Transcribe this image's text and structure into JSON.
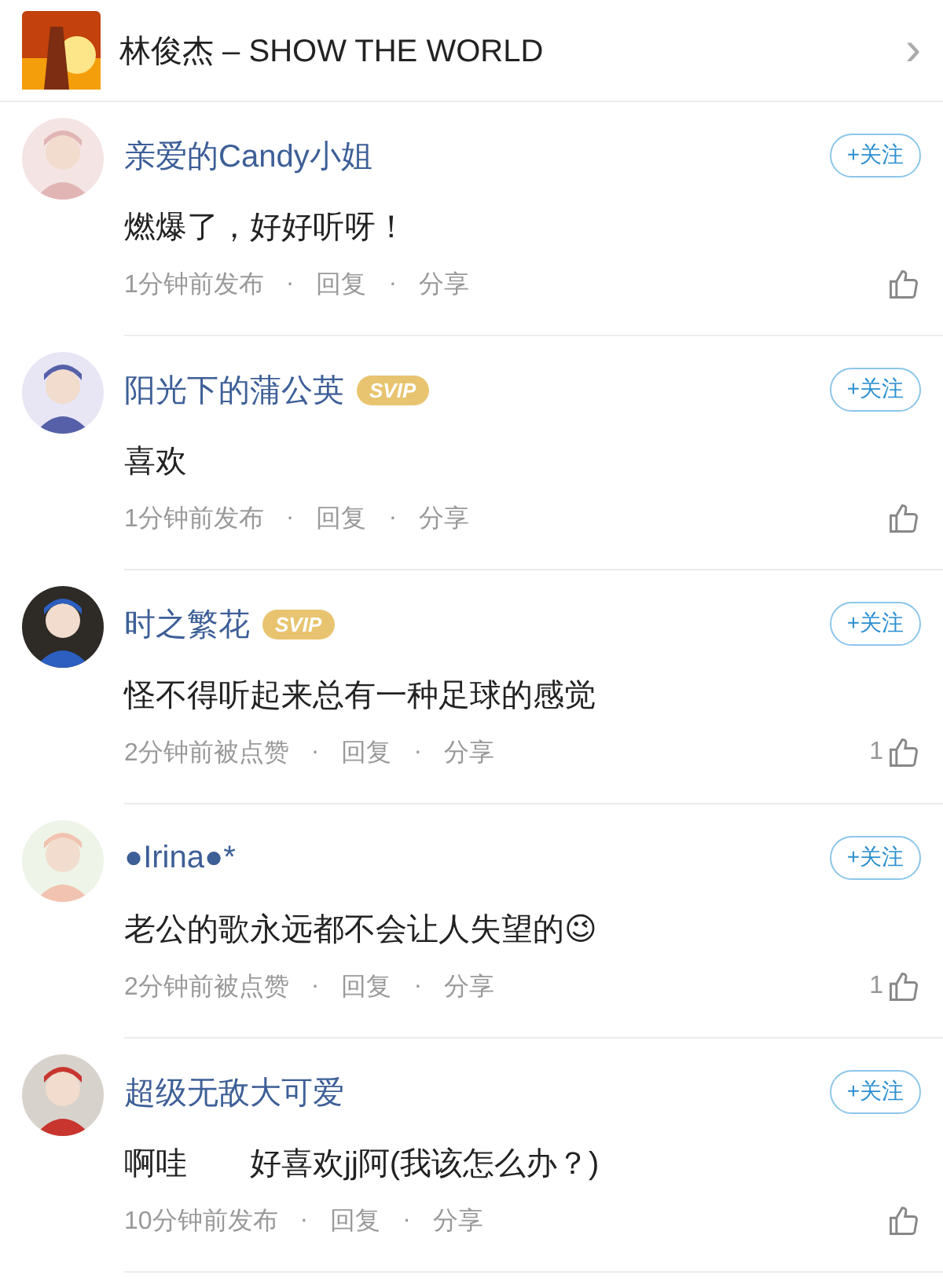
{
  "header": {
    "title": "林俊杰 – SHOW THE WORLD",
    "chevron": "›"
  },
  "comments": [
    {
      "name": "亲爱的Candy小姐",
      "follow": "+关注",
      "text": "燃爆了，好好听呀！",
      "meta": [
        "1分钟前发布",
        "·",
        "回复",
        "·",
        "分享"
      ]
    },
    {
      "name": "阳光下的蒲公英",
      "badge": "SVIP",
      "follow": "+关注",
      "text": "喜欢",
      "meta": [
        "1分钟前发布",
        "·",
        "回复",
        "·",
        "分享"
      ]
    },
    {
      "name": "时之繁花",
      "badge": "SVIP",
      "follow": "+关注",
      "text": "怪不得听起来总有一种足球的感觉",
      "meta": [
        "2分钟前被点赞",
        "·",
        "回复",
        "·",
        "分享"
      ],
      "likes": "1"
    },
    {
      "name": "●Irina●*",
      "follow": "+关注",
      "text": "老公的歌永远都不会让人失望的😉",
      "meta": [
        "2分钟前被点赞",
        "·",
        "回复",
        "·",
        "分享"
      ],
      "likes": "1"
    },
    {
      "name": "超级无敌大可爱",
      "follow": "+关注",
      "text": "啊哇　　好喜欢jj阿(我该怎么办？)",
      "meta": [
        "10分钟前发布",
        "·",
        "回复",
        "·",
        "分享"
      ]
    }
  ]
}
